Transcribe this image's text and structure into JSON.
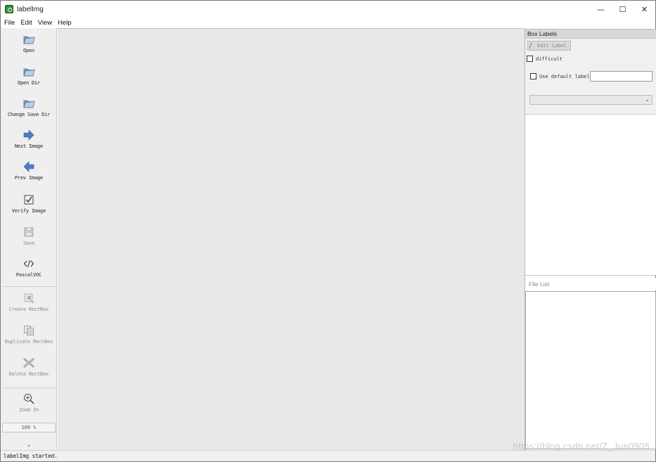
{
  "window": {
    "title": "labelImg",
    "controls": {
      "minimize": "—",
      "maximize": "☐",
      "close": "✕"
    }
  },
  "menu": [
    "File",
    "Edit",
    "View",
    "Help"
  ],
  "toolbar": {
    "items": [
      {
        "label": "Open",
        "icon": "folder-icon",
        "enabled": true
      },
      {
        "label": "Open Dir",
        "icon": "folder-icon",
        "enabled": true
      },
      {
        "label": "Change Save Dir",
        "icon": "folder-icon",
        "enabled": true
      },
      {
        "label": "Next Image",
        "icon": "arrow-right-icon",
        "enabled": true
      },
      {
        "label": "Prev Image",
        "icon": "arrow-left-icon",
        "enabled": true
      },
      {
        "label": "Verify Image",
        "icon": "checkbox-icon",
        "enabled": true
      },
      {
        "label": "Save",
        "icon": "save-icon",
        "enabled": false
      },
      {
        "label": "PascalVOC",
        "icon": "code-icon",
        "enabled": true
      },
      {
        "label": "Create RectBox",
        "icon": "create-rect-icon",
        "enabled": false
      },
      {
        "label": "Duplicate RectBox",
        "icon": "duplicate-icon",
        "enabled": false
      },
      {
        "label": "Delete RectBox",
        "icon": "delete-icon",
        "enabled": false
      },
      {
        "label": "Zoom In",
        "icon": "zoom-in-icon",
        "enabled": false
      }
    ],
    "zoom_value": "100 %",
    "more": "»"
  },
  "dock": {
    "box_labels_title": "Box Labels",
    "edit_label": "Edit Label",
    "difficult": "difficult",
    "use_default_label": "Use default label",
    "default_label_value": "",
    "label_combo_value": "",
    "file_list_title": "File List"
  },
  "status": "labelImg started.",
  "watermark": "https://blog.csdn.net/Z_Jun0905",
  "colors": {
    "canvas": "#e8e8e8",
    "toolbar": "#efefef",
    "arrow_blue": "#4a7fc1"
  }
}
